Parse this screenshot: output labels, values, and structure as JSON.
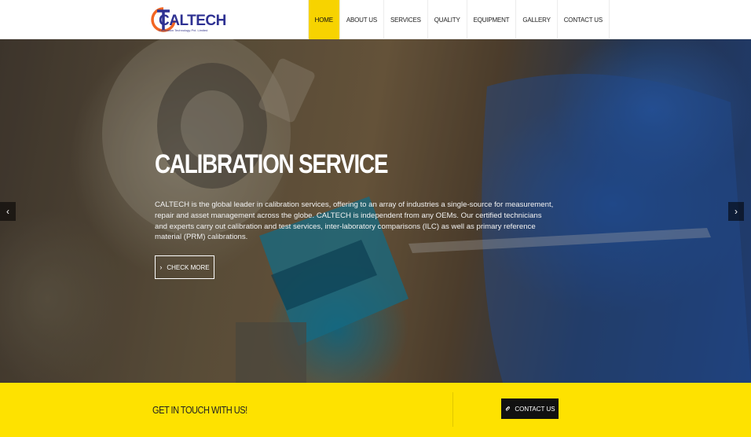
{
  "header": {
    "logo": {
      "text": "CALTECH",
      "subtitle": "Calibration Technology Pvt. Limited"
    },
    "nav": [
      {
        "label": "HOME",
        "active": true
      },
      {
        "label": "ABOUT US",
        "active": false
      },
      {
        "label": "SERVICES",
        "active": false
      },
      {
        "label": "QUALITY",
        "active": false
      },
      {
        "label": "EQUIPMENT",
        "active": false
      },
      {
        "label": "GALLERY",
        "active": false
      },
      {
        "label": "CONTACT US",
        "active": false
      }
    ]
  },
  "hero": {
    "title": "CALIBRATION SERVICE",
    "description": "CALTECH is the global leader in calibration services, offering to an array of industries a single-source for measurement, repair and asset management across the globe. CALTECH is independent from any OEMs. Our certified technicians and experts carry out calibration and test services, inter-laboratory comparisons (ILC) as well as primary reference material (PRM) calibrations.",
    "button_label": "CHECK MORE",
    "prev_icon": "‹",
    "next_icon": "›"
  },
  "cta": {
    "text": "GET IN TOUCH WITH US!",
    "button_label": "CONTACT US"
  },
  "colors": {
    "accent": "#fee200",
    "nav_active": "#f7d300",
    "logo_orange": "#f26522",
    "logo_blue": "#2e3192"
  }
}
